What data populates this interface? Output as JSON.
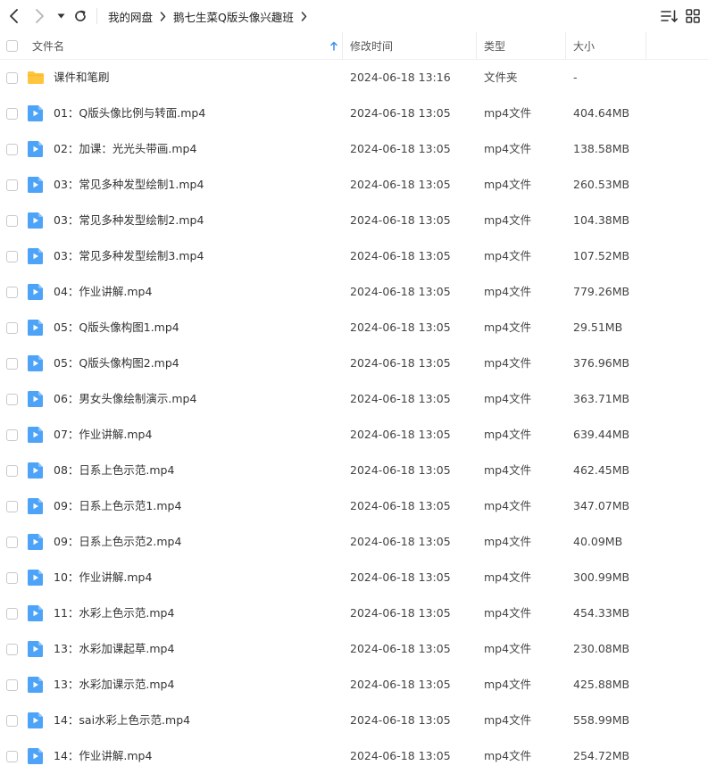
{
  "breadcrumb": {
    "root": "我的网盘",
    "current": "鹅七生菜Q版头像兴趣班"
  },
  "columns": {
    "name": "文件名",
    "modified": "修改时间",
    "type": "类型",
    "size": "大小"
  },
  "colors": {
    "folder": "#FFC53D",
    "video": "#4DA3F7",
    "sort_arrow": "#3C8CF0"
  },
  "icons": {
    "back": "chevron-left-icon",
    "forward": "chevron-right-icon",
    "dropdown": "caret-down-icon",
    "refresh": "refresh-icon",
    "sort": "sort-list-icon",
    "grid": "grid-view-icon",
    "folder": "folder-icon",
    "video": "video-file-icon"
  },
  "files": [
    {
      "kind": "folder",
      "name": "课件和笔刷",
      "modified": "2024-06-18 13:16",
      "type": "文件夹",
      "size": "-"
    },
    {
      "kind": "video",
      "name": "01：Q版头像比例与转面.mp4",
      "modified": "2024-06-18 13:05",
      "type": "mp4文件",
      "size": "404.64MB"
    },
    {
      "kind": "video",
      "name": "02：加课：光光头带画.mp4",
      "modified": "2024-06-18 13:05",
      "type": "mp4文件",
      "size": "138.58MB"
    },
    {
      "kind": "video",
      "name": "03：常见多种发型绘制1.mp4",
      "modified": "2024-06-18 13:05",
      "type": "mp4文件",
      "size": "260.53MB"
    },
    {
      "kind": "video",
      "name": "03：常见多种发型绘制2.mp4",
      "modified": "2024-06-18 13:05",
      "type": "mp4文件",
      "size": "104.38MB"
    },
    {
      "kind": "video",
      "name": "03：常见多种发型绘制3.mp4",
      "modified": "2024-06-18 13:05",
      "type": "mp4文件",
      "size": "107.52MB"
    },
    {
      "kind": "video",
      "name": "04：作业讲解.mp4",
      "modified": "2024-06-18 13:05",
      "type": "mp4文件",
      "size": "779.26MB"
    },
    {
      "kind": "video",
      "name": "05：Q版头像构图1.mp4",
      "modified": "2024-06-18 13:05",
      "type": "mp4文件",
      "size": "29.51MB"
    },
    {
      "kind": "video",
      "name": "05：Q版头像构图2.mp4",
      "modified": "2024-06-18 13:05",
      "type": "mp4文件",
      "size": "376.96MB"
    },
    {
      "kind": "video",
      "name": "06：男女头像绘制演示.mp4",
      "modified": "2024-06-18 13:05",
      "type": "mp4文件",
      "size": "363.71MB"
    },
    {
      "kind": "video",
      "name": "07：作业讲解.mp4",
      "modified": "2024-06-18 13:05",
      "type": "mp4文件",
      "size": "639.44MB"
    },
    {
      "kind": "video",
      "name": "08：日系上色示范.mp4",
      "modified": "2024-06-18 13:05",
      "type": "mp4文件",
      "size": "462.45MB"
    },
    {
      "kind": "video",
      "name": "09：日系上色示范1.mp4",
      "modified": "2024-06-18 13:05",
      "type": "mp4文件",
      "size": "347.07MB"
    },
    {
      "kind": "video",
      "name": "09：日系上色示范2.mp4",
      "modified": "2024-06-18 13:05",
      "type": "mp4文件",
      "size": "40.09MB"
    },
    {
      "kind": "video",
      "name": "10：作业讲解.mp4",
      "modified": "2024-06-18 13:05",
      "type": "mp4文件",
      "size": "300.99MB"
    },
    {
      "kind": "video",
      "name": "11：水彩上色示范.mp4",
      "modified": "2024-06-18 13:05",
      "type": "mp4文件",
      "size": "454.33MB"
    },
    {
      "kind": "video",
      "name": "13：水彩加课起草.mp4",
      "modified": "2024-06-18 13:05",
      "type": "mp4文件",
      "size": "230.08MB"
    },
    {
      "kind": "video",
      "name": "13：水彩加课示范.mp4",
      "modified": "2024-06-18 13:05",
      "type": "mp4文件",
      "size": "425.88MB"
    },
    {
      "kind": "video",
      "name": "14：sai水彩上色示范.mp4",
      "modified": "2024-06-18 13:05",
      "type": "mp4文件",
      "size": "558.99MB"
    },
    {
      "kind": "video",
      "name": "14：作业讲解.mp4",
      "modified": "2024-06-18 13:05",
      "type": "mp4文件",
      "size": "254.72MB"
    }
  ]
}
